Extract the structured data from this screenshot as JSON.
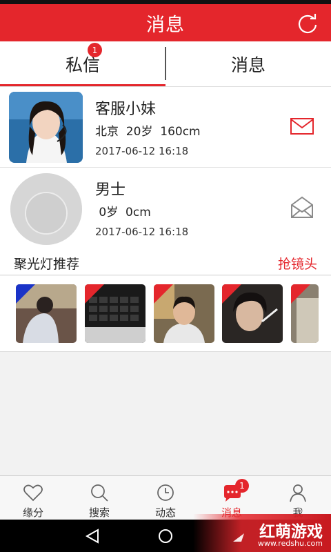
{
  "header": {
    "title": "消息"
  },
  "tabs": [
    {
      "label": "私信",
      "badge": "1",
      "active": true
    },
    {
      "label": "消息",
      "active": false
    }
  ],
  "conversations": [
    {
      "name": "客服小妹",
      "meta": "北京  20岁  160cm",
      "time": "2017-06-12 16:18",
      "mail_icon": "mail-red-icon",
      "read": false
    },
    {
      "name": "男士",
      "meta": " 0岁  0cm",
      "time": "2017-06-12 16:18",
      "mail_icon": "mail-open-gray-icon",
      "read": true
    }
  ],
  "spotlight": {
    "title": "聚光灯推荐",
    "action": "抢镜头",
    "thumbs": [
      {
        "corner": "blue"
      },
      {
        "corner": "red"
      },
      {
        "corner": "red"
      },
      {
        "corner": "red"
      },
      {
        "corner": "red"
      }
    ]
  },
  "tabbar": [
    {
      "label": "缘分",
      "icon": "heart-icon"
    },
    {
      "label": "搜索",
      "icon": "search-icon"
    },
    {
      "label": "动态",
      "icon": "clock-icon"
    },
    {
      "label": "消息",
      "icon": "chat-bubble-icon",
      "badge": "1",
      "active": true
    },
    {
      "label": "我",
      "icon": "person-icon"
    }
  ],
  "watermark": {
    "main": "红萌游戏",
    "sub": "www.redshu.com"
  },
  "colors": {
    "accent": "#e4262c",
    "blue_corner": "#1a33c8"
  }
}
